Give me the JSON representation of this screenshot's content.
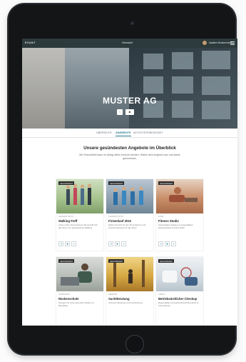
{
  "header": {
    "brand": "EVANT",
    "nav_center": "Übersicht",
    "user_name": "Nadine Mustermann"
  },
  "hero": {
    "title": "MUSTER AG",
    "btn_icon_left": "‹",
    "btn_icon_right": "■"
  },
  "tabs": [
    {
      "label": "ÜBERSICHT",
      "active": false
    },
    {
      "label": "ANGEBOTE",
      "active": true
    },
    {
      "label": "AKTIVITÄTEN",
      "active": false
    },
    {
      "label": "KONTAKT",
      "active": false
    }
  ],
  "section": {
    "heading": "Unsere gesündesten Angebote im Überblick",
    "intro": "Mit Gesundheit kann im Alltag vieles erreicht werden. Wähle dein Angebot aus und starte gemeinsam."
  },
  "cards": [
    {
      "badge": "GESUNDHEIT",
      "meta": "TEAMAKTIVITÄT",
      "title": "Walking-Treff",
      "desc": "Jeden ersten Donnerstag im Monat trifft sich das Team zum gemeinsamen Walking."
    },
    {
      "badge": "GESUNDHEIT",
      "meta": "TEAMAKTIVITÄT",
      "title": "Firmenlauf 2015",
      "desc": "Melde dich jetzt für den Firmenlauf an und sammle Kilometer für das Team."
    },
    {
      "badge": "GESUNDHEIT",
      "meta": "KURS",
      "title": "Fitness Studio",
      "desc": "Vergünstigter Zugang zu ausgewählten Fitnessstudios in deiner Nähe."
    },
    {
      "badge": "GESUNDHEIT",
      "meta": "WORKSHOP",
      "title": "Rückenschule",
      "desc": "Übungen für einen gesunden Rücken im Büroalltag."
    },
    {
      "badge": "GESUNDHEIT",
      "meta": "SEMINAR",
      "title": "Suchtberatung",
      "desc": "Anonyme Beratung und Unterstützung."
    },
    {
      "badge": "GESUNDHEIT",
      "meta": "CHECK",
      "title": "Betriebsärztlicher Checkup",
      "desc": "Regelmäßige Vorsorgeuntersuchung direkt im Unternehmen."
    }
  ],
  "actions": {
    "share": "↗",
    "like": "♥",
    "save": "+"
  },
  "colors": {
    "accent": "#2a7d8f",
    "topbar": "#2d3a3c"
  }
}
